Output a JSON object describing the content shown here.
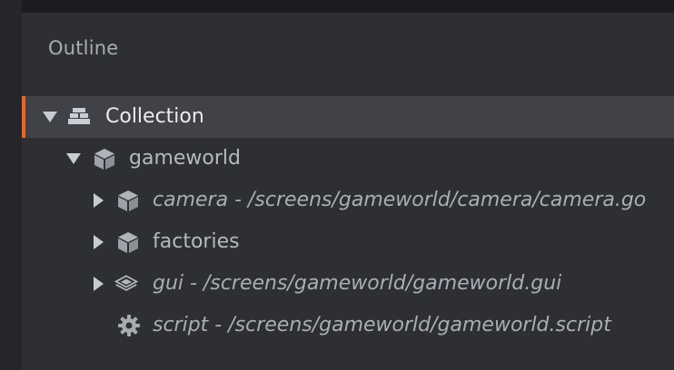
{
  "panel": {
    "title": "Outline"
  },
  "tree": {
    "collection": {
      "label": "Collection",
      "expanded": true,
      "icon": "collection-icon"
    },
    "gameworld": {
      "label": "gameworld",
      "expanded": true,
      "icon": "game-object-icon"
    },
    "camera": {
      "label": "camera - /screens/gameworld/camera/camera.go",
      "expanded": false,
      "icon": "game-object-icon"
    },
    "factories": {
      "label": "factories",
      "expanded": false,
      "icon": "game-object-icon"
    },
    "gui": {
      "label": "gui - /screens/gameworld/gameworld.gui",
      "expanded": false,
      "icon": "gui-layers-icon"
    },
    "script": {
      "label": "script - /screens/gameworld/gameworld.script",
      "icon": "gear-icon"
    }
  },
  "colors": {
    "selection_accent": "#e46a2c",
    "panel_bg": "#2e2f33",
    "selected_row_bg": "#404247"
  }
}
